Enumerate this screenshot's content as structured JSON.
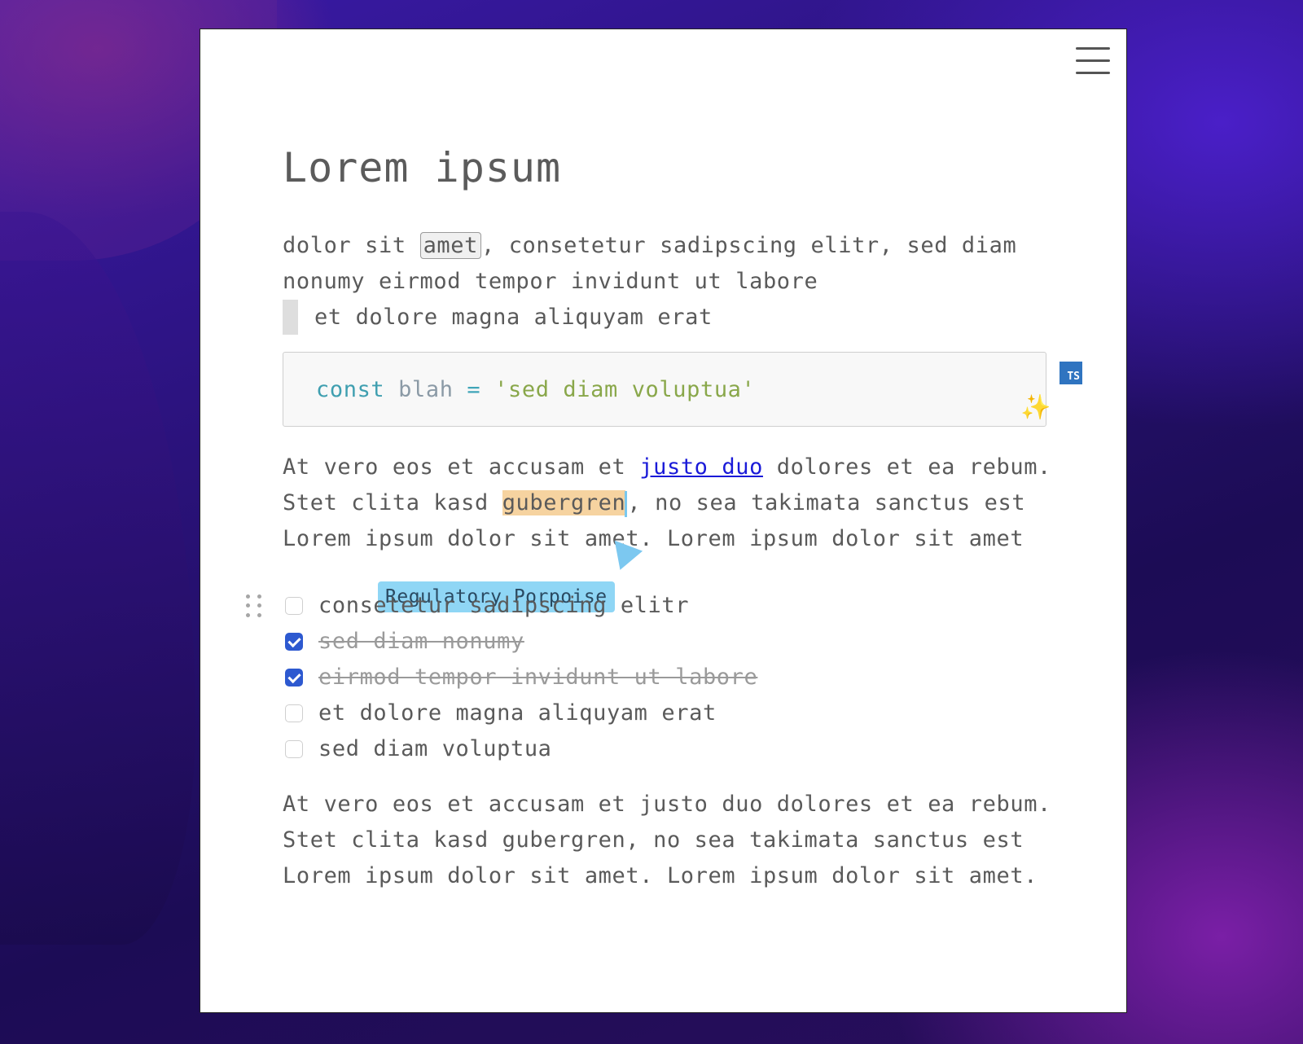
{
  "document": {
    "title": "Lorem ipsum",
    "para1": {
      "before": "dolor sit ",
      "marked": "amet",
      "after": ", consetetur sadipscing elitr, sed diam nonumy eirmod tempor invidunt ut labore"
    },
    "quote": "et dolore magna aliquyam erat",
    "code": {
      "keyword": "const",
      "identifier": "blah",
      "operator": "=",
      "string": "'sed diam voluptua'",
      "language_badge": "TS",
      "sparkle_icon": "sparkles-icon"
    },
    "para2": {
      "before": "At vero eos et accusam et ",
      "link": "justo duo",
      "middle": " dolores et ea rebum. Stet clita kasd ",
      "highlight": "gubergren",
      "after": ", no sea takimata sanctus est Lorem ipsum dolor sit amet. Lorem ipsum dolor sit amet"
    },
    "collaborator": {
      "name": "Regulatory Porpoise",
      "color": "#8fd6f5"
    },
    "tasks": [
      {
        "label": "consetetur sadipscing elitr",
        "checked": false
      },
      {
        "label": "sed diam nonumy",
        "checked": true
      },
      {
        "label": "eirmod tempor invidunt ut labore",
        "checked": true
      },
      {
        "label": "et dolore magna aliquyam erat",
        "checked": false
      },
      {
        "label": "sed diam voluptua",
        "checked": false
      }
    ],
    "para3": "At vero eos et accusam et justo duo dolores et ea rebum. Stet clita kasd gubergren, no sea takimata sanctus est Lorem ipsum dolor sit amet. Lorem ipsum dolor sit amet."
  },
  "colors": {
    "highlight": "#f6d3a0",
    "link": "#1a1ad8",
    "checkbox_checked": "#2d59d0",
    "badge": "#2f74c0"
  }
}
